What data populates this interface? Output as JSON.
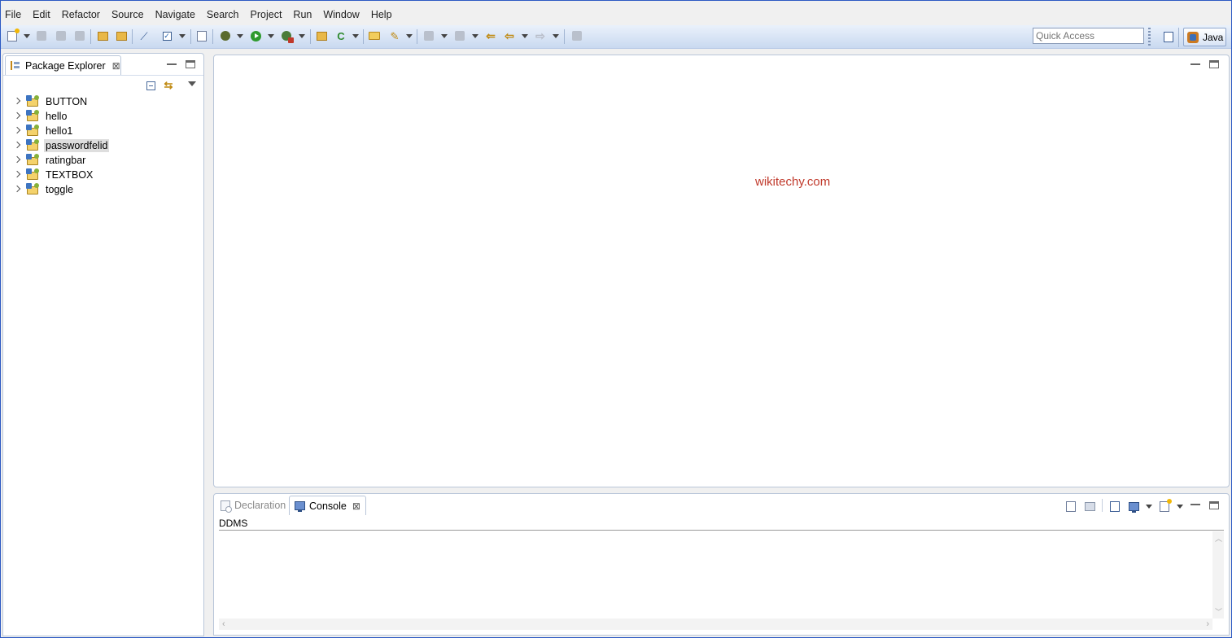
{
  "menu": [
    "File",
    "Edit",
    "Refactor",
    "Source",
    "Navigate",
    "Search",
    "Project",
    "Run",
    "Window",
    "Help"
  ],
  "toolbar": {
    "quick_access_placeholder": "Quick Access",
    "perspective_label": "Java"
  },
  "package_explorer": {
    "title": "Package Explorer",
    "projects": [
      "BUTTON",
      "hello",
      "hello1",
      "passwordfelid",
      "ratingbar",
      "TEXTBOX",
      "toggle"
    ],
    "selected": "passwordfelid"
  },
  "editor": {
    "watermark": "wikitechy.com"
  },
  "bottom_panel": {
    "tabs": [
      {
        "label": "Declaration",
        "active": false
      },
      {
        "label": "Console",
        "active": true
      }
    ],
    "console_name": "DDMS"
  },
  "colors": {
    "watermark": "#c0392b",
    "toolbar_top": "#eaf1fb",
    "toolbar_bottom": "#c9d9f0",
    "selection": "#dedede"
  }
}
